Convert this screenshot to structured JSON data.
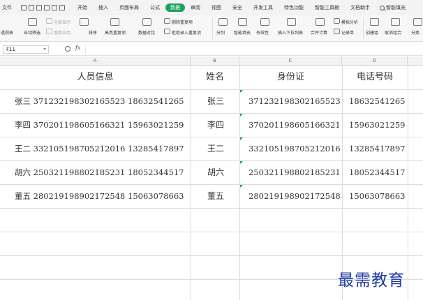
{
  "menubar": {
    "file": "文件",
    "tabs": [
      "开始",
      "插入",
      "页面布局",
      "公式",
      "数据",
      "审阅",
      "视图",
      "安全",
      "开发工具",
      "特色功能",
      "智能工具箱",
      "文档助手"
    ],
    "active_tab": "数据",
    "search_label": "智能填充"
  },
  "ribbon": {
    "pivot": "透视表",
    "autofilter": "自动筛选",
    "show_all": "全部显示",
    "reapply": "重新应用",
    "sort": "排序",
    "highlight_dup": "高亮重复项",
    "compare": "数据对比",
    "remove_dup": "删除重复项",
    "reject_dup": "拒绝录入重复项",
    "split": "分列",
    "smart_fill": "智能填充",
    "validity": "有效性",
    "dropdown": "插入下拉列表",
    "consolidate": "合并计算",
    "simulate": "模拟分析",
    "record": "记录单",
    "create_group": "创建组",
    "ungroup": "取消组合",
    "subtotal": "分类"
  },
  "formula_bar": {
    "cell_ref": "F11",
    "fx": "fx",
    "value": ""
  },
  "columns": [
    "A",
    "B",
    "C",
    "D"
  ],
  "headers": {
    "a": "人员信息",
    "b": "姓名",
    "c": "身份证",
    "d": "电话号码"
  },
  "rows": [
    {
      "a": "张三  371232198302165523  18632541265",
      "b": "张三",
      "c": "371232198302165523",
      "d": "18632541265"
    },
    {
      "a": "李四  370201198605166321  15963021259",
      "b": "李四",
      "c": "370201198605166321",
      "d": "15963021259"
    },
    {
      "a": "王二  332105198705212016  13285417897",
      "b": "王二",
      "c": "332105198705212016",
      "d": "13285417897"
    },
    {
      "a": "胡六  250321198802185231  18052344517",
      "b": "胡六",
      "c": "250321198802185231",
      "d": "18052344517"
    },
    {
      "a": "董五  280219198902172548  15063078663",
      "b": "董五",
      "c": "280219198902172548",
      "d": "15063078663"
    }
  ],
  "watermark": "最需教育",
  "colors": {
    "accent": "#1aa260",
    "watermark": "#1f3aa6"
  }
}
